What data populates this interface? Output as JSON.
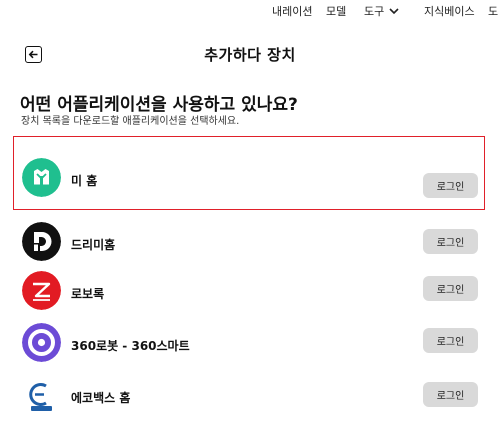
{
  "topnav": {
    "items": [
      "내레이션",
      "모델",
      "도구",
      "지식베이스",
      "도"
    ]
  },
  "header": {
    "title": "추가하다 장치"
  },
  "question": "어떤 어플리케이션을 사용하고 있나요?",
  "subtitle": "장치 목록을 다운로드할 애플리케이션을 선택하세요.",
  "apps": [
    {
      "name": "미 홈",
      "login": "로그인",
      "icon": "mi-home-icon",
      "color": "#1fbf8f"
    },
    {
      "name": "드리미홈",
      "login": "로그인",
      "icon": "dreame-icon",
      "color": "#111111"
    },
    {
      "name": "로보록",
      "login": "로그인",
      "icon": "roborock-icon",
      "color": "#e21b23"
    },
    {
      "name": "360로봇 - 360스마트",
      "login": "로그인",
      "icon": "360-robot-icon",
      "color": "#6c4bd6"
    },
    {
      "name": "에코백스 홈",
      "login": "로그인",
      "icon": "ecovacs-icon",
      "color": "#1f5fa8"
    }
  ],
  "accent": "#e0202a"
}
